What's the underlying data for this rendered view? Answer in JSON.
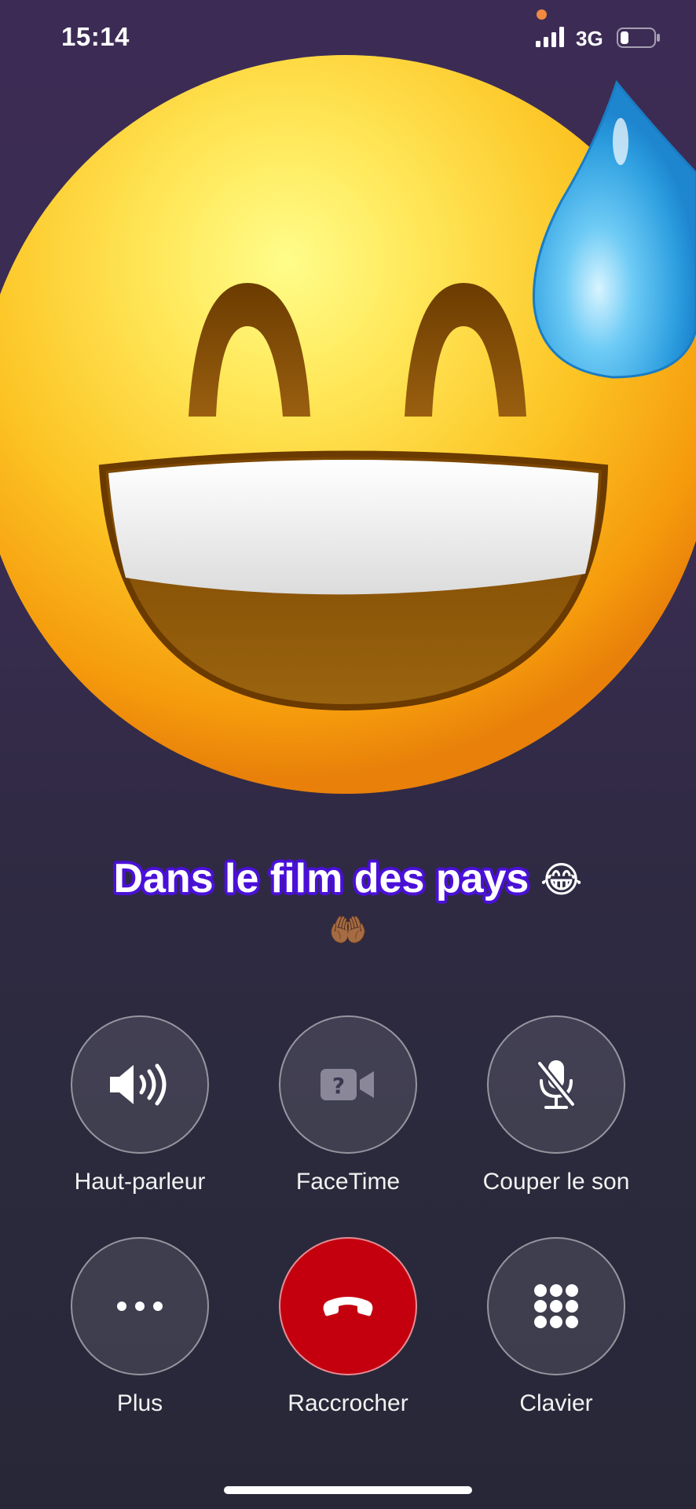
{
  "status_bar": {
    "time": "15:14",
    "network": "3G",
    "privacy_dot_color": "#f08a40",
    "signal_icon": "signal-bars-icon",
    "battery_icon": "battery-low-icon"
  },
  "contact": {
    "avatar_icon": "grinning-face-with-sweat-emoji",
    "name": "Dans le film des pays",
    "name_emoji": "😂",
    "subline_emoji": "🤲🏾"
  },
  "controls": [
    {
      "id": "speaker",
      "label": "Haut-parleur",
      "icon": "speaker-icon"
    },
    {
      "id": "facetime",
      "label": "FaceTime",
      "icon": "facetime-video-icon"
    },
    {
      "id": "mute",
      "label": "Couper le son",
      "icon": "microphone-slash-icon"
    },
    {
      "id": "more",
      "label": "Plus",
      "icon": "ellipsis-icon"
    },
    {
      "id": "end",
      "label": "Raccrocher",
      "icon": "end-call-icon"
    },
    {
      "id": "keypad",
      "label": "Clavier",
      "icon": "keypad-icon"
    }
  ],
  "colors": {
    "end_call": "#c4000f",
    "name_outline": "#4a10d8",
    "background_top": "#3c2c55",
    "background_bottom": "#272738"
  }
}
